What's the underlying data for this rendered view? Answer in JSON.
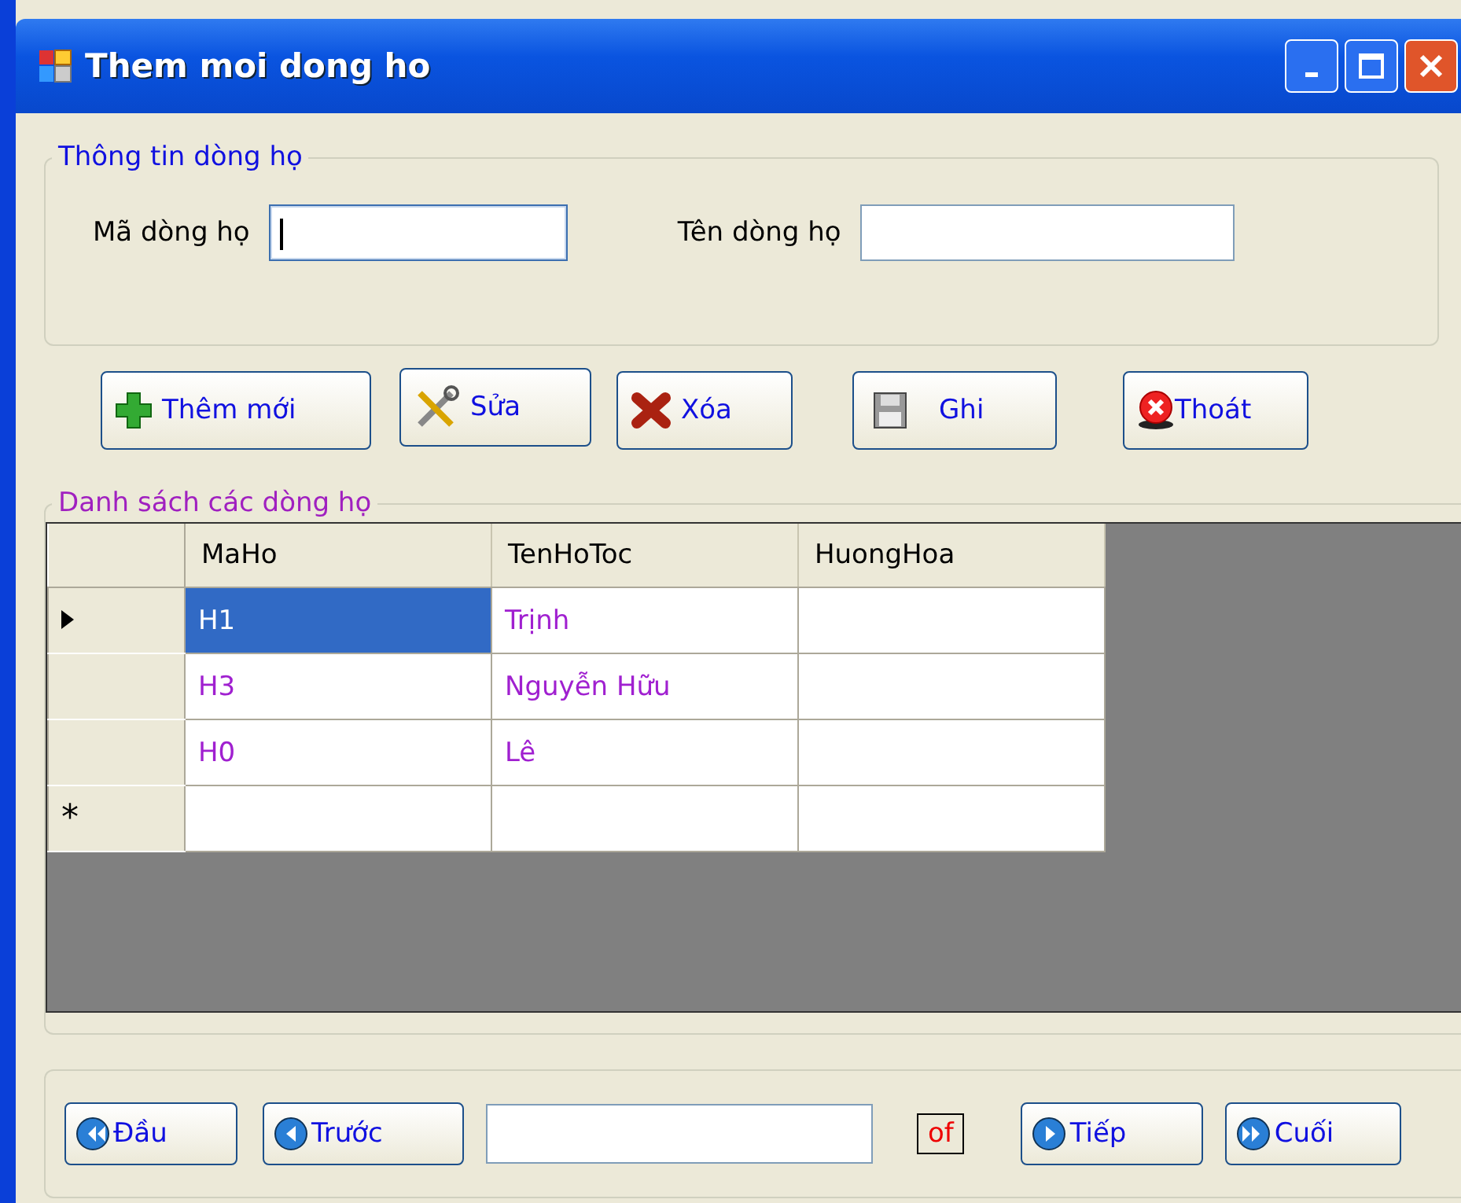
{
  "window": {
    "title": "Them moi dong ho"
  },
  "info_group": {
    "title": "Thông tin dòng họ",
    "fields": [
      {
        "label": "Mã dòng họ",
        "focused": true
      },
      {
        "label": "Tên dòng họ",
        "focused": false
      }
    ]
  },
  "actions": [
    {
      "label": "Thêm mới",
      "kind": "add"
    },
    {
      "label": "Sửa",
      "kind": "edit"
    },
    {
      "label": "Xóa",
      "kind": "delete"
    },
    {
      "label": "Ghi",
      "kind": "save"
    },
    {
      "label": "Thoát",
      "kind": "exit"
    }
  ],
  "list_group": {
    "title": "Danh sách các dòng họ"
  },
  "table": {
    "columns": [
      "MaHo",
      "TenHoToc",
      "HuongHoa"
    ],
    "rows": [
      {
        "kind": "data",
        "current": true,
        "cells": [
          {
            "text": "H1",
            "selected": true
          },
          {
            "text": "Trịnh",
            "selected": false
          },
          {
            "selected": false
          }
        ]
      },
      {
        "kind": "data",
        "current": false,
        "cells": [
          {
            "text": "H3",
            "selected": false
          },
          {
            "text": "Nguyễn Hữu",
            "selected": false
          },
          {
            "selected": false
          }
        ]
      },
      {
        "kind": "data",
        "current": false,
        "cells": [
          {
            "text": "H0",
            "selected": false
          },
          {
            "text": "Lê",
            "selected": false
          },
          {
            "selected": false
          }
        ]
      },
      {
        "kind": "new",
        "marker": "*",
        "cells": [
          {
            "selected": false
          },
          {
            "selected": false
          },
          {
            "selected": false
          }
        ]
      }
    ]
  },
  "navigator": {
    "buttons_left": [
      {
        "label": "Đầu",
        "kind": "first"
      },
      {
        "label": "Trước",
        "kind": "prev"
      }
    ],
    "count_label": "of",
    "buttons_right": [
      {
        "label": "Tiếp",
        "kind": "next"
      },
      {
        "label": "Cuối",
        "kind": "last"
      }
    ]
  }
}
